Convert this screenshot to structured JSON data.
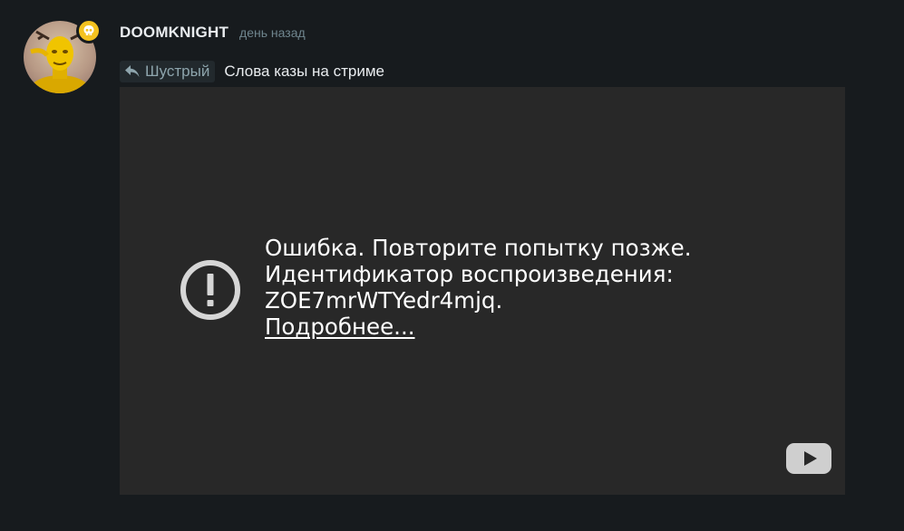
{
  "comment": {
    "username": "DOOMKNIGHT",
    "timestamp": "день назад",
    "reply_to": "Шустрый",
    "text": "Слова казы на стриме"
  },
  "player": {
    "error_line1": "Ошибка. Повторите попытку позже.",
    "error_line2": "Идентификатор воспроизведения:",
    "error_line3": "ZOE7mrWTYedr4mjq.",
    "learn_more": "Подробнее..."
  },
  "icons": {
    "badge": "skull-icon",
    "reply": "reply-arrow-icon",
    "error": "exclamation-circle-icon",
    "logo": "youtube-logo-icon"
  },
  "colors": {
    "background": "#171b1e",
    "player_bg": "#282828",
    "badge": "#f4c21f",
    "muted": "#6f858e",
    "reply_name": "#8ea5ad"
  }
}
